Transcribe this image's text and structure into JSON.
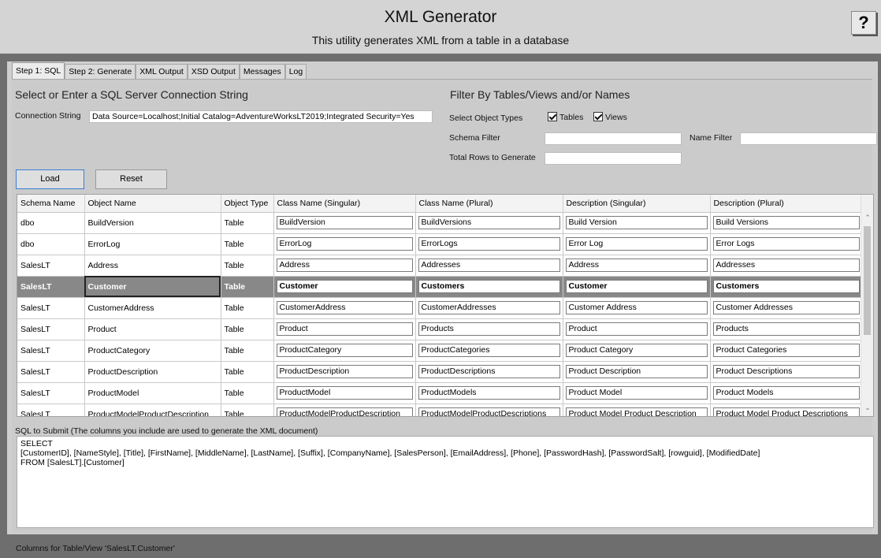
{
  "header": {
    "title": "XML Generator",
    "subtitle": "This utility generates XML from a table in a database",
    "help_label": "?"
  },
  "tabs": [
    {
      "label": "Step 1: SQL",
      "active": true
    },
    {
      "label": "Step 2: Generate",
      "active": false
    },
    {
      "label": "XML Output",
      "active": false
    },
    {
      "label": "XSD Output",
      "active": false
    },
    {
      "label": "Messages",
      "active": false
    },
    {
      "label": "Log",
      "active": false
    }
  ],
  "connection": {
    "section_title": "Select or Enter a SQL Server Connection String",
    "label": "Connection String",
    "value": "Data Source=Localhost;Initial Catalog=AdventureWorksLT2019;Integrated Security=Yes"
  },
  "filter": {
    "section_title": "Filter By Tables/Views and/or Names",
    "object_types_label": "Select Object Types",
    "tables_label": "Tables",
    "tables_checked": true,
    "views_label": "Views",
    "views_checked": true,
    "schema_filter_label": "Schema Filter",
    "schema_filter_value": "",
    "name_filter_label": "Name Filter",
    "name_filter_value": "",
    "total_rows_label": "Total Rows to Generate",
    "total_rows_value": ""
  },
  "buttons": {
    "load": "Load",
    "reset": "Reset"
  },
  "grid": {
    "columns": [
      "Schema Name",
      "Object Name",
      "Object Type",
      "Class Name (Singular)",
      "Class Name (Plural)",
      "Description (Singular)",
      "Description (Plural)"
    ],
    "selected_index": 3,
    "rows": [
      [
        "dbo",
        "BuildVersion",
        "Table",
        "BuildVersion",
        "BuildVersions",
        "Build Version",
        "Build Versions"
      ],
      [
        "dbo",
        "ErrorLog",
        "Table",
        "ErrorLog",
        "ErrorLogs",
        "Error Log",
        "Error Logs"
      ],
      [
        "SalesLT",
        "Address",
        "Table",
        "Address",
        "Addresses",
        "Address",
        "Addresses"
      ],
      [
        "SalesLT",
        "Customer",
        "Table",
        "Customer",
        "Customers",
        "Customer",
        "Customers"
      ],
      [
        "SalesLT",
        "CustomerAddress",
        "Table",
        "CustomerAddress",
        "CustomerAddresses",
        "Customer Address",
        "Customer Addresses"
      ],
      [
        "SalesLT",
        "Product",
        "Table",
        "Product",
        "Products",
        "Product",
        "Products"
      ],
      [
        "SalesLT",
        "ProductCategory",
        "Table",
        "ProductCategory",
        "ProductCategories",
        "Product Category",
        "Product Categories"
      ],
      [
        "SalesLT",
        "ProductDescription",
        "Table",
        "ProductDescription",
        "ProductDescriptions",
        "Product Description",
        "Product Descriptions"
      ],
      [
        "SalesLT",
        "ProductModel",
        "Table",
        "ProductModel",
        "ProductModels",
        "Product Model",
        "Product Models"
      ],
      [
        "SalesLT",
        "ProductModelProductDescription",
        "Table",
        "ProductModelProductDescription",
        "ProductModelProductDescriptions",
        "Product Model Product Description",
        "Product Model Product Descriptions"
      ]
    ]
  },
  "sql": {
    "label": "SQL to Submit (The columns you include are used to generate the XML document)",
    "text": "SELECT\n[CustomerID], [NameStyle], [Title], [FirstName], [MiddleName], [LastName], [Suffix], [CompanyName], [SalesPerson], [EmailAddress], [Phone], [PasswordHash], [PasswordSalt], [rowguid], [ModifiedDate]\nFROM [SalesLT].[Customer]"
  },
  "status": {
    "text": "Columns for Table/View 'SalesLT.Customer'"
  }
}
